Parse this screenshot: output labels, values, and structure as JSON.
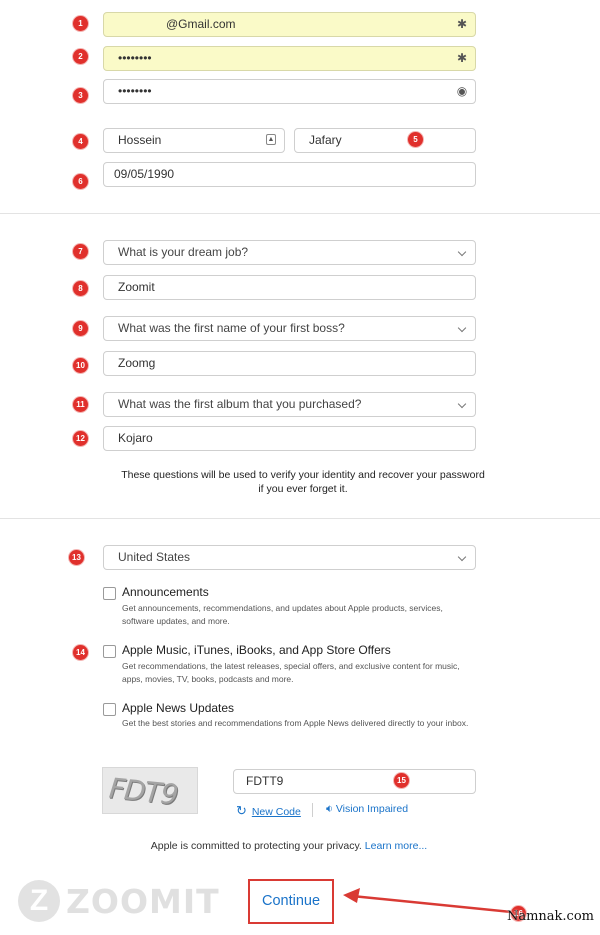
{
  "email": {
    "value": "@Gmail.com"
  },
  "password": {
    "value": "••••••••"
  },
  "confirm_password": {
    "value": "••••••••"
  },
  "first_name": {
    "value": "Hossein"
  },
  "last_name": {
    "value": "Jafary"
  },
  "birthday": {
    "value": "09/05/1990"
  },
  "security": {
    "q1": {
      "question": "What is your dream job?",
      "answer": "Zoomit"
    },
    "q2": {
      "question": "What was the first name of your first boss?",
      "answer": "Zoomg"
    },
    "q3": {
      "question": "What was the first album that you purchased?",
      "answer": "Kojaro"
    },
    "note": "These questions will be used to verify your identity and recover your password if you ever forget it."
  },
  "country": {
    "value": "United States"
  },
  "subscriptions": [
    {
      "title": "Announcements",
      "desc": "Get announcements, recommendations, and updates about Apple products, services, software updates, and more."
    },
    {
      "title": "Apple Music, iTunes, iBooks, and App Store Offers",
      "desc": "Get recommendations, the latest releases, special offers, and exclusive content for music, apps, movies, TV, books, podcasts and more."
    },
    {
      "title": "Apple News Updates",
      "desc": "Get the best stories and recommendations from Apple News delivered directly to your inbox."
    }
  ],
  "captcha": {
    "image_text": "FDT9",
    "input_value": "FDTT9",
    "new_code_label": "New Code",
    "vision_label": "Vision Impaired"
  },
  "privacy": {
    "text": "Apple is committed to protecting your privacy.",
    "link": "Learn more..."
  },
  "continue_label": "Continue",
  "badges": [
    "1",
    "2",
    "3",
    "4",
    "5",
    "6",
    "7",
    "8",
    "9",
    "10",
    "11",
    "12",
    "13",
    "14",
    "15",
    "16"
  ],
  "logo": {
    "mark": "Z",
    "word": "ZOOMIT"
  },
  "watermark": "Namnak.com",
  "colors": {
    "badge": "#e0302c",
    "link": "#1a73c9",
    "arrow": "#d93a34",
    "autofill": "#fafac8"
  },
  "icons": {
    "field_right": "asterisk-icon",
    "password_eye": "eye-icon",
    "contact_card": "contact-card-icon",
    "select": "chevron-down-icon",
    "refresh": "refresh-icon",
    "speaker": "speaker-icon"
  }
}
